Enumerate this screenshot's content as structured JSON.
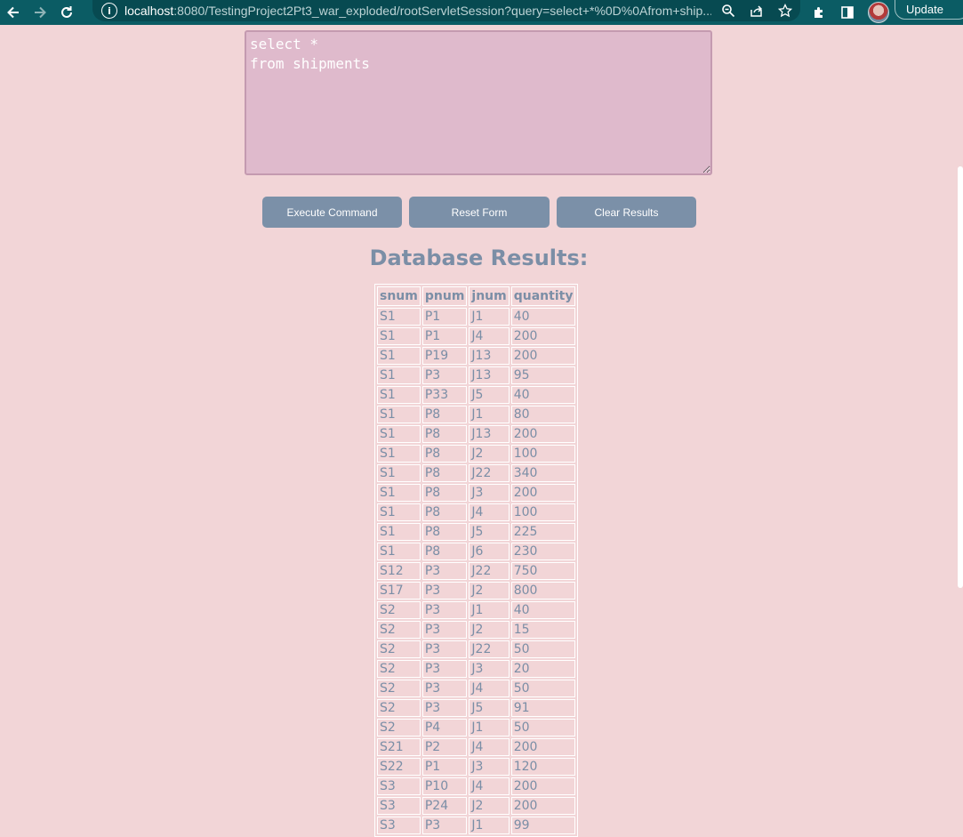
{
  "browser": {
    "url_host": "localhost",
    "url_rest": ":8080/TestingProject2Pt3_war_exploded/rootServletSession?query=select+*%0D%0Afrom+ship...",
    "update_label": "Update"
  },
  "query": {
    "text": "select *\nfrom shipments"
  },
  "buttons": {
    "execute": "Execute Command",
    "reset": "Reset Form",
    "clear": "Clear Results"
  },
  "results": {
    "title": "Database Results:",
    "columns": [
      "snum",
      "pnum",
      "jnum",
      "quantity"
    ],
    "rows": [
      [
        "S1",
        "P1",
        "J1",
        "40"
      ],
      [
        "S1",
        "P1",
        "J4",
        "200"
      ],
      [
        "S1",
        "P19",
        "J13",
        "200"
      ],
      [
        "S1",
        "P3",
        "J13",
        "95"
      ],
      [
        "S1",
        "P33",
        "J5",
        "40"
      ],
      [
        "S1",
        "P8",
        "J1",
        "80"
      ],
      [
        "S1",
        "P8",
        "J13",
        "200"
      ],
      [
        "S1",
        "P8",
        "J2",
        "100"
      ],
      [
        "S1",
        "P8",
        "J22",
        "340"
      ],
      [
        "S1",
        "P8",
        "J3",
        "200"
      ],
      [
        "S1",
        "P8",
        "J4",
        "100"
      ],
      [
        "S1",
        "P8",
        "J5",
        "225"
      ],
      [
        "S1",
        "P8",
        "J6",
        "230"
      ],
      [
        "S12",
        "P3",
        "J22",
        "750"
      ],
      [
        "S17",
        "P3",
        "J2",
        "800"
      ],
      [
        "S2",
        "P3",
        "J1",
        "40"
      ],
      [
        "S2",
        "P3",
        "J2",
        "15"
      ],
      [
        "S2",
        "P3",
        "J22",
        "50"
      ],
      [
        "S2",
        "P3",
        "J3",
        "20"
      ],
      [
        "S2",
        "P3",
        "J4",
        "50"
      ],
      [
        "S2",
        "P3",
        "J5",
        "91"
      ],
      [
        "S2",
        "P4",
        "J1",
        "50"
      ],
      [
        "S21",
        "P2",
        "J4",
        "200"
      ],
      [
        "S22",
        "P1",
        "J3",
        "120"
      ],
      [
        "S3",
        "P10",
        "J4",
        "200"
      ],
      [
        "S3",
        "P24",
        "J2",
        "200"
      ],
      [
        "S3",
        "P3",
        "J1",
        "99"
      ]
    ]
  },
  "icons": [
    "back-arrow-icon",
    "forward-arrow-icon",
    "reload-icon",
    "info-icon",
    "zoom-icon",
    "share-icon",
    "star-icon",
    "extensions-icon",
    "side-panel-icon"
  ]
}
